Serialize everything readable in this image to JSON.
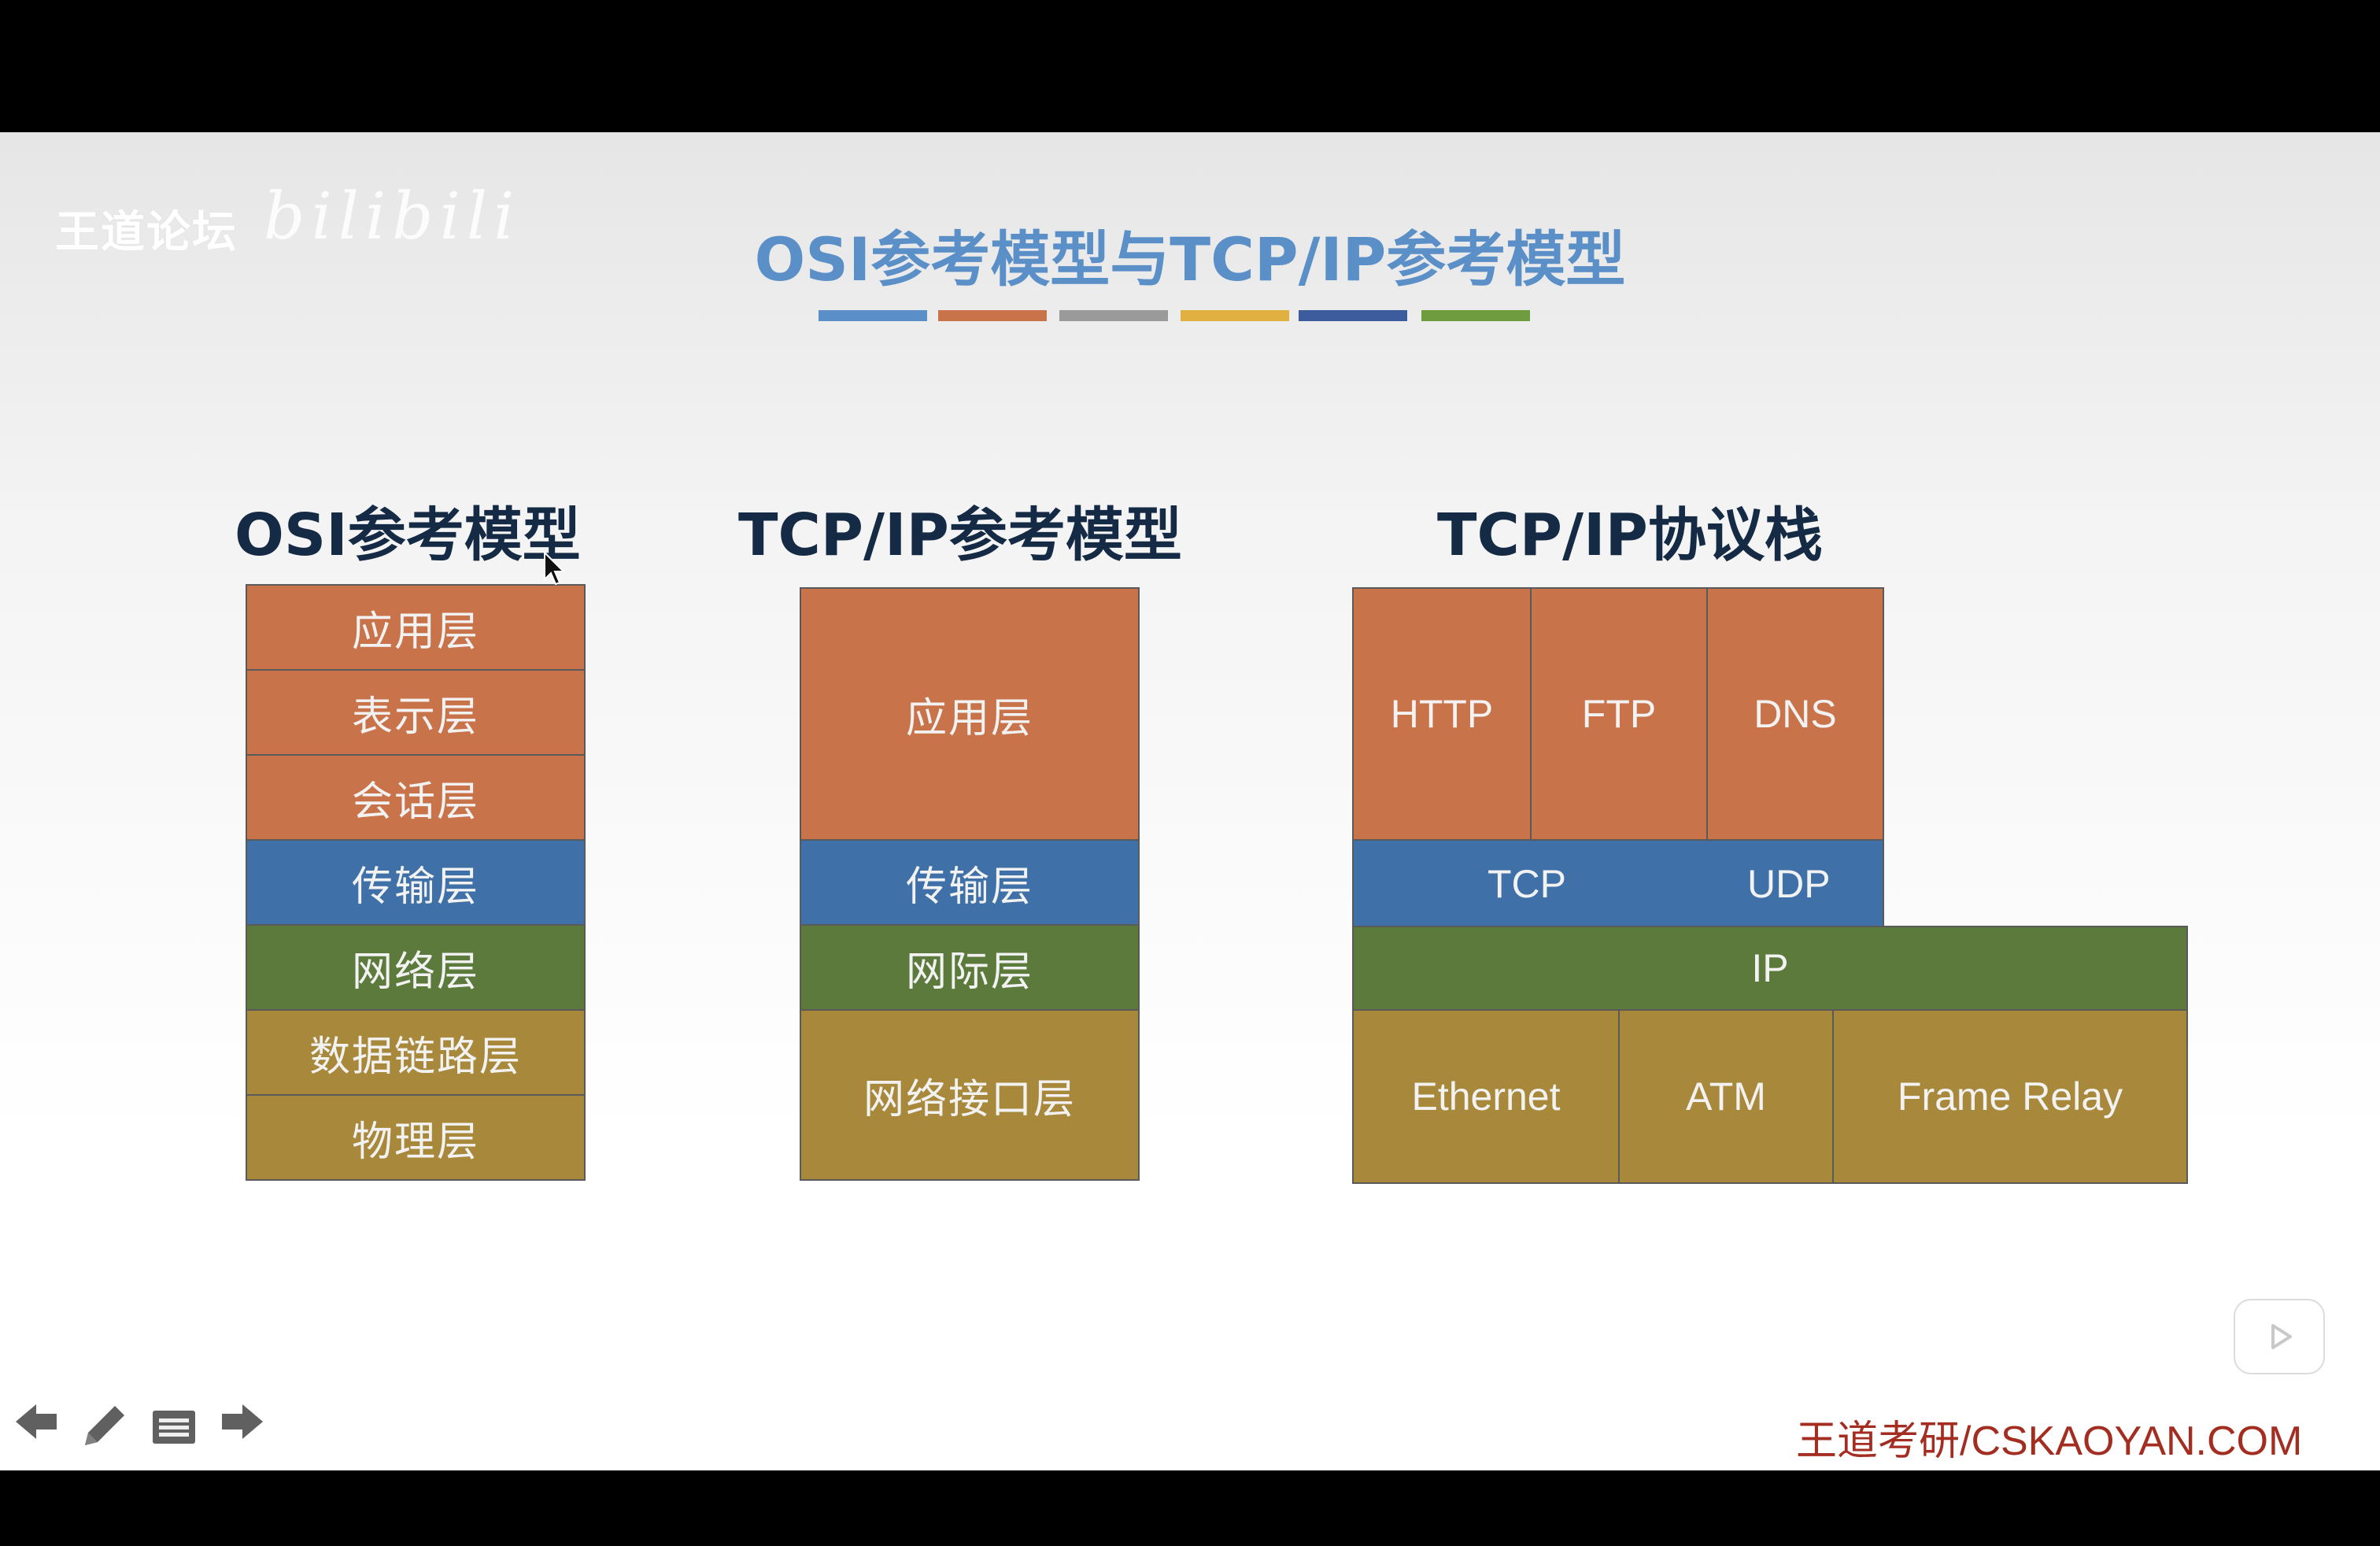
{
  "watermark": {
    "brand": "王道论坛",
    "logo": "bilibili"
  },
  "title": "OSI参考模型与TCP/IP参考模型",
  "title_bar_colors": [
    "#5b8fc7",
    "#c9734a",
    "#9a9a9a",
    "#e0b040",
    "#3d5c9e",
    "#6f9c3f"
  ],
  "osi": {
    "heading": "OSI参考模型",
    "layers": [
      "应用层",
      "表示层",
      "会话层",
      "传输层",
      "网络层",
      "数据链路层",
      "物理层"
    ]
  },
  "tcpip_model": {
    "heading": "TCP/IP参考模型",
    "layers": [
      "应用层",
      "传输层",
      "网际层",
      "网络接口层"
    ]
  },
  "tcpip_stack": {
    "heading": "TCP/IP协议栈",
    "app": [
      "HTTP",
      "FTP",
      "DNS"
    ],
    "transport": [
      "TCP",
      "UDP"
    ],
    "network": "IP",
    "link": [
      "Ethernet",
      "ATM",
      "Frame Relay"
    ]
  },
  "colors": {
    "application": "#c9734a",
    "transport": "#3f70a7",
    "network": "#5c7a3c",
    "link": "#a8893b"
  },
  "footer": "王道考研/CSKAOYAN.COM",
  "icons": [
    "arrow-left-icon",
    "pencil-icon",
    "menu-icon",
    "arrow-right-icon",
    "play-icon",
    "cursor-icon"
  ]
}
